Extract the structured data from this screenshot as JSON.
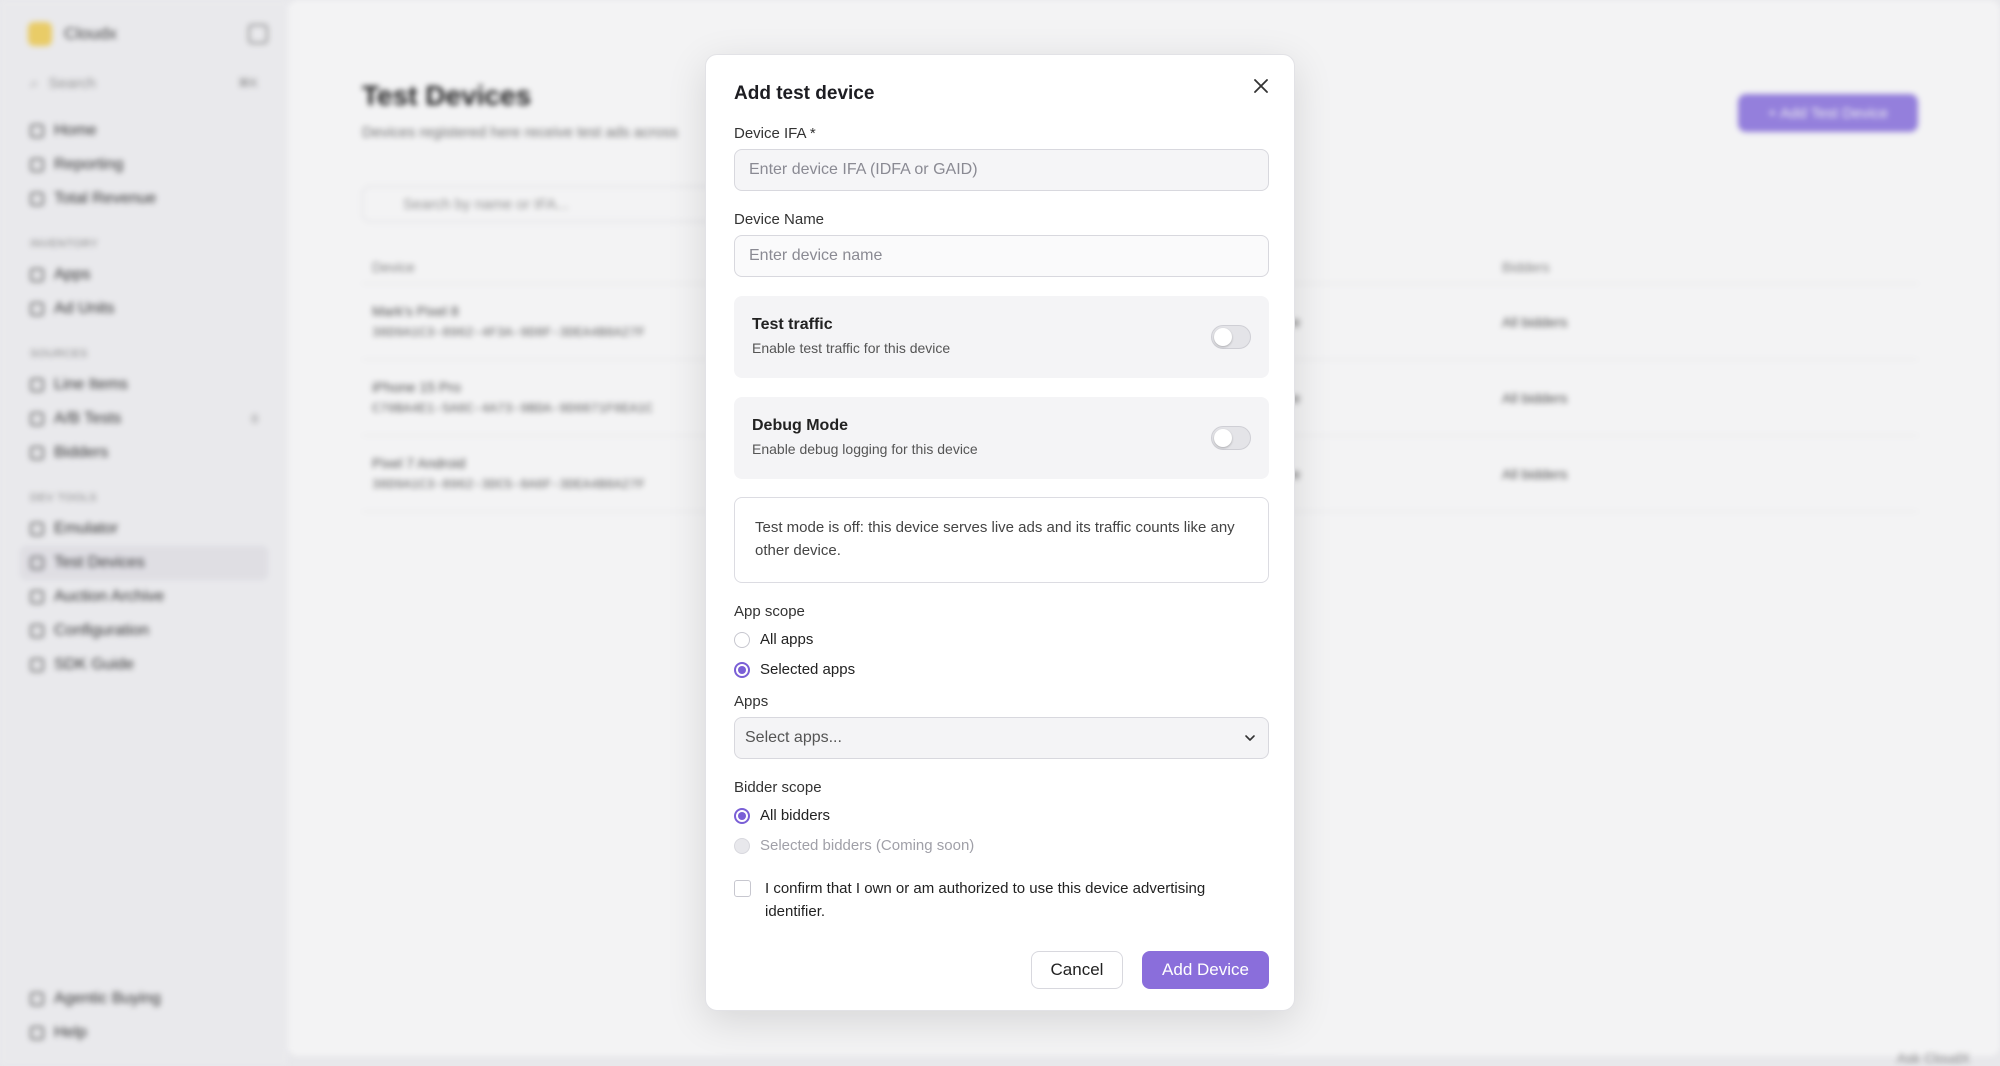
{
  "background": {
    "brand": "Cloudx",
    "search_placeholder": "Search",
    "search_kbd": "⌘K",
    "nav_main": [
      "Home",
      "Reporting",
      "Total Revenue"
    ],
    "section_inventory": "INVENTORY",
    "nav_inventory": [
      "Apps",
      "Ad Units"
    ],
    "section_sources": "SOURCES",
    "nav_sources": [
      "Line Items",
      "A/B Tests",
      "Bidders"
    ],
    "ab_badge": "0",
    "section_tools": "DEV TOOLS",
    "nav_tools": [
      "Emulator",
      "Test Devices",
      "Auction Archive",
      "Configuration",
      "SDK Guide"
    ],
    "nav_bottom": [
      "Agentic Buying",
      "Help"
    ],
    "page_title": "Test Devices",
    "page_subtitle": "Devices registered here receive test ads across",
    "add_button": "+ Add Test Device",
    "table_search_placeholder": "Search by name or IFA...",
    "columns": [
      "Device",
      "",
      "Bidders"
    ],
    "rows": [
      {
        "name": "Mark's Pixel 8",
        "ifa": "38D9A1C3-8962-4F3A-9D8F-3DEA4B8A27F",
        "status": "Active",
        "bidders": "All bidders"
      },
      {
        "name": "iPhone 15 Pro",
        "ifa": "C70BA4E1-5A6C-4A73-9BDA-9D0871F6EA1C",
        "status": "Active",
        "bidders": "All bidders"
      },
      {
        "name": "Pixel 7 Android",
        "ifa": "38D9A1C3-8962-3DC5-8A6F-3DEA4B8A27F",
        "status": "Active",
        "bidders": "All bidders"
      }
    ],
    "ask_label": "Ask CloudX"
  },
  "modal": {
    "title": "Add test device",
    "ifa_label": "Device IFA *",
    "ifa_placeholder": "Enter device IFA (IDFA or GAID)",
    "name_label": "Device Name",
    "name_placeholder": "Enter device name",
    "test_traffic_title": "Test traffic",
    "test_traffic_desc": "Enable test traffic for this device",
    "debug_title": "Debug Mode",
    "debug_desc": "Enable debug logging for this device",
    "info_text": "Test mode is off: this device serves live ads and its traffic counts like any other device.",
    "app_scope_label": "App scope",
    "app_scope_all": "All apps",
    "app_scope_selected": "Selected apps",
    "apps_label": "Apps",
    "apps_placeholder": "Select apps...",
    "bidder_scope_label": "Bidder scope",
    "bidder_all": "All bidders",
    "bidder_selected": "Selected bidders (Coming soon)",
    "confirm_text": "I confirm that I own or am authorized to use this device advertising identifier.",
    "cancel_label": "Cancel",
    "add_label": "Add Device"
  },
  "colors": {
    "accent": "#8a6edb",
    "accent_light": "#9b85e6"
  }
}
